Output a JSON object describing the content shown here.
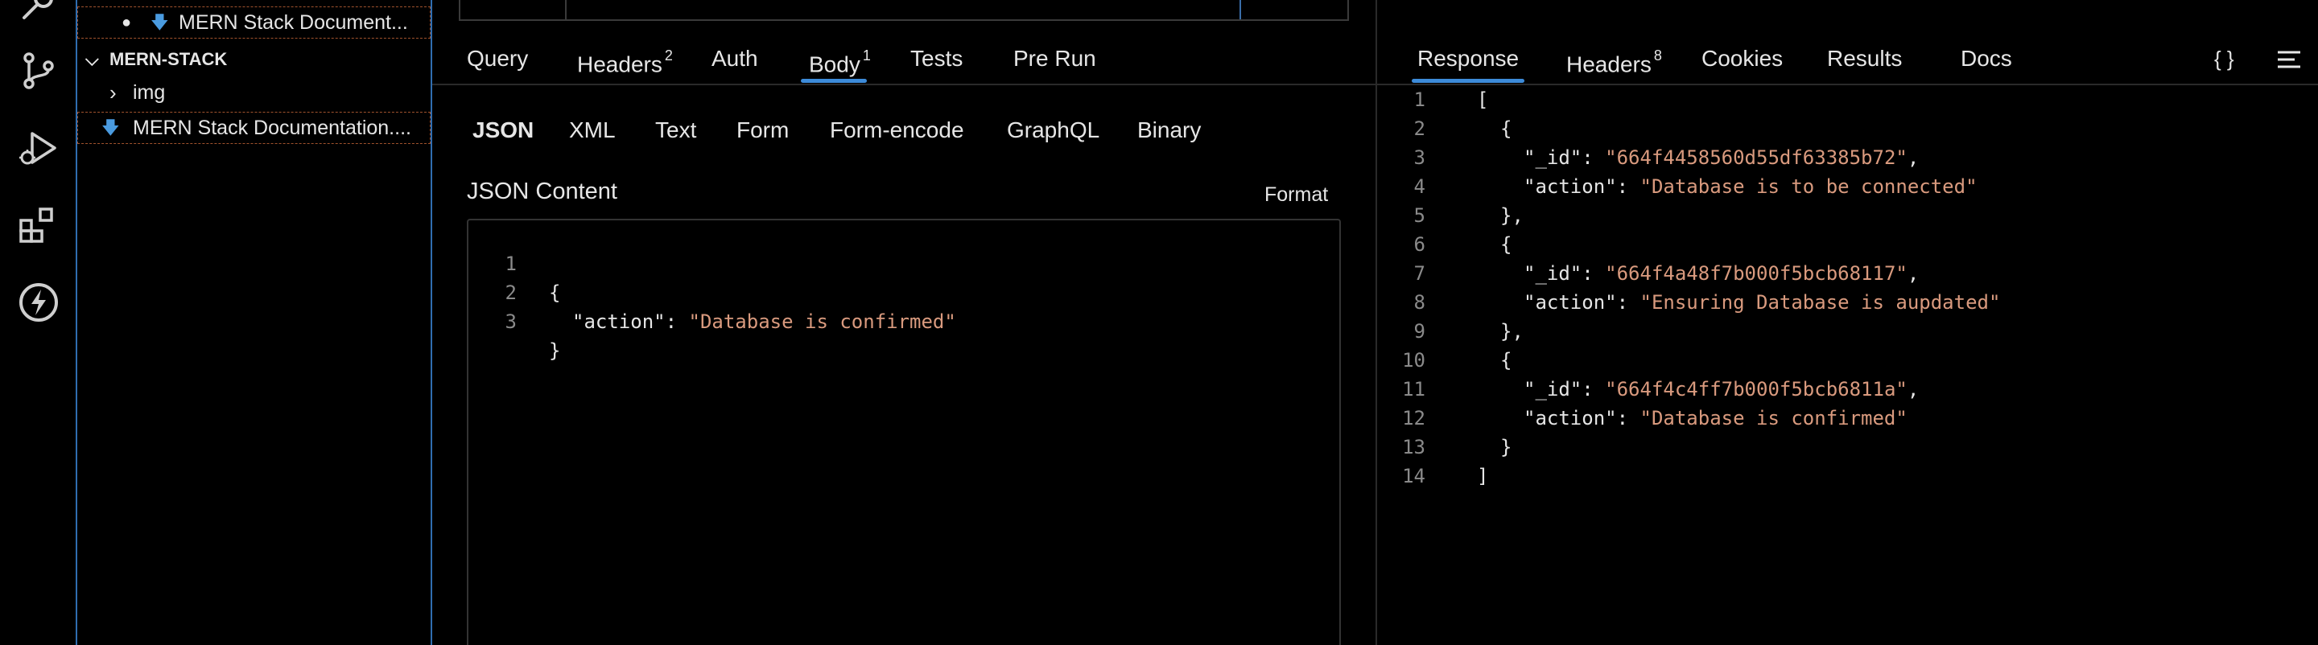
{
  "explorer": {
    "open_file": "MERN Stack Document...",
    "folder": "MERN-STACK",
    "items": [
      {
        "label": "img"
      },
      {
        "label": "MERN Stack Documentation...."
      }
    ]
  },
  "request": {
    "tabs": [
      {
        "label": "Query",
        "badge": ""
      },
      {
        "label": "Headers",
        "badge": "2"
      },
      {
        "label": "Auth",
        "badge": ""
      },
      {
        "label": "Body",
        "badge": "1"
      },
      {
        "label": "Tests",
        "badge": ""
      },
      {
        "label": "Pre Run",
        "badge": ""
      }
    ],
    "active_tab": "Body",
    "body_types": [
      "JSON",
      "XML",
      "Text",
      "Form",
      "Form-encode",
      "GraphQL",
      "Binary"
    ],
    "active_body_type": "JSON",
    "content_label": "JSON Content",
    "format_label": "Format",
    "editor_lines": [
      {
        "num": "1",
        "text": "{"
      },
      {
        "num": "2",
        "key": "\"action\"",
        "value": "\"Database is confirmed\""
      },
      {
        "num": "3",
        "text": "}"
      }
    ]
  },
  "response": {
    "tabs": [
      {
        "label": "Response",
        "badge": ""
      },
      {
        "label": "Headers",
        "badge": "8"
      },
      {
        "label": "Cookies",
        "badge": ""
      },
      {
        "label": "Results",
        "badge": ""
      },
      {
        "label": "Docs",
        "badge": ""
      }
    ],
    "active_tab": "Response",
    "braces_icon_label": "{ }",
    "lines": [
      {
        "num": "1",
        "indent": 0,
        "text": "["
      },
      {
        "num": "2",
        "indent": 1,
        "text": "{"
      },
      {
        "num": "3",
        "indent": 2,
        "key": "\"_id\"",
        "value": "\"664f4458560d55df63385b72\"",
        "comma": ","
      },
      {
        "num": "4",
        "indent": 2,
        "key": "\"action\"",
        "value": "\"Database is to be connected\"",
        "comma": ""
      },
      {
        "num": "5",
        "indent": 1,
        "text": "},"
      },
      {
        "num": "6",
        "indent": 1,
        "text": "{"
      },
      {
        "num": "7",
        "indent": 2,
        "key": "\"_id\"",
        "value": "\"664f4a48f7b000f5bcb68117\"",
        "comma": ","
      },
      {
        "num": "8",
        "indent": 2,
        "key": "\"action\"",
        "value": "\"Ensuring Database is aupdated\"",
        "comma": ""
      },
      {
        "num": "9",
        "indent": 1,
        "text": "},"
      },
      {
        "num": "10",
        "indent": 1,
        "text": "{"
      },
      {
        "num": "11",
        "indent": 2,
        "key": "\"_id\"",
        "value": "\"664f4c4ff7b000f5bcb6811a\"",
        "comma": ","
      },
      {
        "num": "12",
        "indent": 2,
        "key": "\"action\"",
        "value": "\"Database is confirmed\"",
        "comma": ""
      },
      {
        "num": "13",
        "indent": 1,
        "text": "}"
      },
      {
        "num": "14",
        "indent": 0,
        "text": "]"
      }
    ]
  },
  "colors": {
    "accent": "#3d8bd9",
    "string": "#d99a7e",
    "line_number": "#8a8a8a"
  }
}
